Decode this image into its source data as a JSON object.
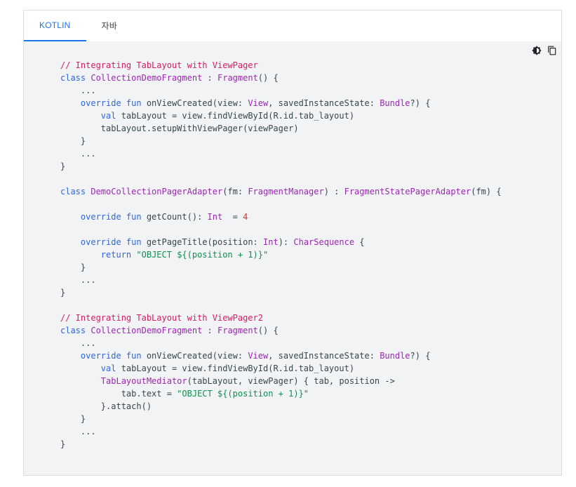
{
  "tabs": [
    {
      "label": "KOTLIN",
      "active": true
    },
    {
      "label": "자바",
      "active": false
    }
  ],
  "toolbar": {
    "theme_icon": "brightness-contrast-icon",
    "copy_icon": "copy-icon"
  },
  "colors": {
    "accent": "#1a73e8",
    "comment": "#d81b60",
    "keyword": "#3367d6",
    "type": "#9c27b0",
    "string": "#0d904f",
    "number": "#c53929",
    "code_bg": "#f1f3f4"
  },
  "code_lines": [
    [
      [
        "comment",
        "// Integrating TabLayout with ViewPager"
      ]
    ],
    [
      [
        "keyword",
        "class"
      ],
      [
        "plain",
        " "
      ],
      [
        "type",
        "CollectionDemoFragment"
      ],
      [
        "plain",
        " : "
      ],
      [
        "type",
        "Fragment"
      ],
      [
        "plain",
        "() {"
      ]
    ],
    [
      [
        "plain",
        "    ..."
      ]
    ],
    [
      [
        "plain",
        "    "
      ],
      [
        "keyword",
        "override fun"
      ],
      [
        "plain",
        " onViewCreated(view: "
      ],
      [
        "type",
        "View"
      ],
      [
        "plain",
        ", savedInstanceState: "
      ],
      [
        "type",
        "Bundle"
      ],
      [
        "plain",
        "?) {"
      ]
    ],
    [
      [
        "plain",
        "        "
      ],
      [
        "keyword",
        "val"
      ],
      [
        "plain",
        " tabLayout = view.findViewById(R.id.tab_layout)"
      ]
    ],
    [
      [
        "plain",
        "        tabLayout.setupWithViewPager(viewPager)"
      ]
    ],
    [
      [
        "plain",
        "    }"
      ]
    ],
    [
      [
        "plain",
        "    ..."
      ]
    ],
    [
      [
        "plain",
        "}"
      ]
    ],
    [
      [
        "plain",
        ""
      ]
    ],
    [
      [
        "keyword",
        "class"
      ],
      [
        "plain",
        " "
      ],
      [
        "type",
        "DemoCollectionPagerAdapter"
      ],
      [
        "plain",
        "(fm: "
      ],
      [
        "type",
        "FragmentManager"
      ],
      [
        "plain",
        ") : "
      ],
      [
        "type",
        "FragmentStatePagerAdapter"
      ],
      [
        "plain",
        "(fm) {"
      ]
    ],
    [
      [
        "plain",
        ""
      ]
    ],
    [
      [
        "plain",
        "    "
      ],
      [
        "keyword",
        "override fun"
      ],
      [
        "plain",
        " getCount(): "
      ],
      [
        "type",
        "Int"
      ],
      [
        "plain",
        "  = "
      ],
      [
        "number",
        "4"
      ]
    ],
    [
      [
        "plain",
        ""
      ]
    ],
    [
      [
        "plain",
        "    "
      ],
      [
        "keyword",
        "override fun"
      ],
      [
        "plain",
        " getPageTitle(position: "
      ],
      [
        "type",
        "Int"
      ],
      [
        "plain",
        "): "
      ],
      [
        "type",
        "CharSequence"
      ],
      [
        "plain",
        " {"
      ]
    ],
    [
      [
        "plain",
        "        "
      ],
      [
        "keyword",
        "return"
      ],
      [
        "plain",
        " "
      ],
      [
        "string",
        "\"OBJECT ${(position + 1)}\""
      ]
    ],
    [
      [
        "plain",
        "    }"
      ]
    ],
    [
      [
        "plain",
        "    ..."
      ]
    ],
    [
      [
        "plain",
        "}"
      ]
    ],
    [
      [
        "plain",
        ""
      ]
    ],
    [
      [
        "comment",
        "// Integrating TabLayout with ViewPager2"
      ]
    ],
    [
      [
        "keyword",
        "class"
      ],
      [
        "plain",
        " "
      ],
      [
        "type",
        "CollectionDemoFragment"
      ],
      [
        "plain",
        " : "
      ],
      [
        "type",
        "Fragment"
      ],
      [
        "plain",
        "() {"
      ]
    ],
    [
      [
        "plain",
        "    ..."
      ]
    ],
    [
      [
        "plain",
        "    "
      ],
      [
        "keyword",
        "override fun"
      ],
      [
        "plain",
        " onViewCreated(view: "
      ],
      [
        "type",
        "View"
      ],
      [
        "plain",
        ", savedInstanceState: "
      ],
      [
        "type",
        "Bundle"
      ],
      [
        "plain",
        "?) {"
      ]
    ],
    [
      [
        "plain",
        "        "
      ],
      [
        "keyword",
        "val"
      ],
      [
        "plain",
        " tabLayout = view.findViewById(R.id.tab_layout)"
      ]
    ],
    [
      [
        "plain",
        "        "
      ],
      [
        "type",
        "TabLayoutMediator"
      ],
      [
        "plain",
        "(tabLayout, viewPager) { tab, position ->"
      ]
    ],
    [
      [
        "plain",
        "            tab.text = "
      ],
      [
        "string",
        "\"OBJECT ${(position + 1)}\""
      ]
    ],
    [
      [
        "plain",
        "        }.attach()"
      ]
    ],
    [
      [
        "plain",
        "    }"
      ]
    ],
    [
      [
        "plain",
        "    ..."
      ]
    ],
    [
      [
        "plain",
        "}"
      ]
    ]
  ]
}
